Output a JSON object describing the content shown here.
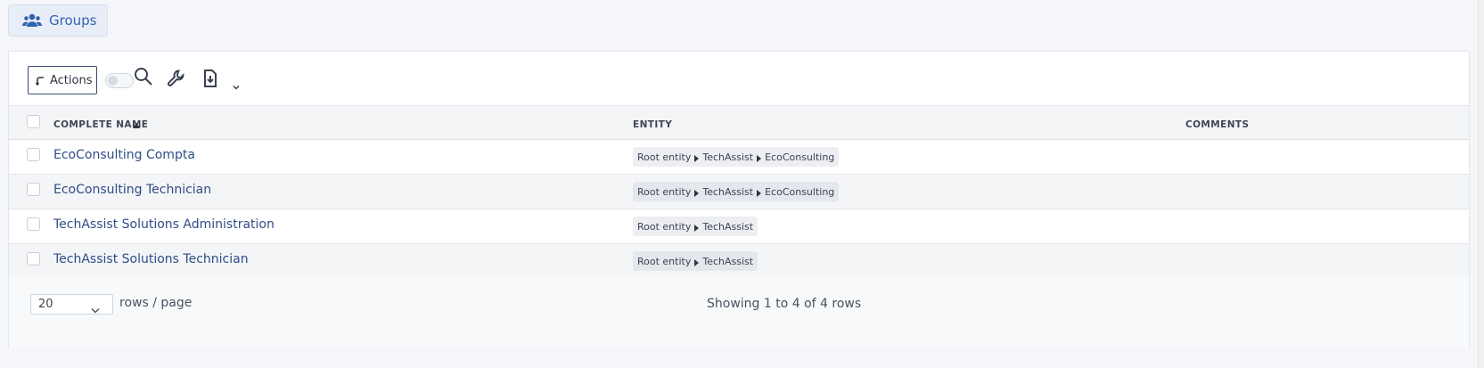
{
  "tab": {
    "label": "Groups",
    "icon": "users-icon"
  },
  "toolbar": {
    "actions_label": "Actions",
    "icons": [
      "search-icon",
      "wrench-icon",
      "export-file-icon"
    ]
  },
  "table": {
    "columns": [
      "Complete name",
      "Entity",
      "Comments"
    ],
    "sorted_column": "Complete name",
    "rows": [
      {
        "name": "EcoConsulting Compta",
        "entity": [
          "Root entity",
          "TechAssist",
          "EcoConsulting"
        ],
        "comments": ""
      },
      {
        "name": "EcoConsulting Technician",
        "entity": [
          "Root entity",
          "TechAssist",
          "EcoConsulting"
        ],
        "comments": ""
      },
      {
        "name": "TechAssist Solutions Administration",
        "entity": [
          "Root entity",
          "TechAssist"
        ],
        "comments": ""
      },
      {
        "name": "TechAssist Solutions Technician",
        "entity": [
          "Root entity",
          "TechAssist"
        ],
        "comments": ""
      }
    ]
  },
  "pagination": {
    "rows_per_page": "20",
    "rows_label": "rows / page",
    "summary": "Showing 1 to 4 of 4 rows"
  },
  "colors": {
    "accent": "#2f63b0",
    "link": "#2f4d87",
    "background": "#f4f6fa"
  }
}
